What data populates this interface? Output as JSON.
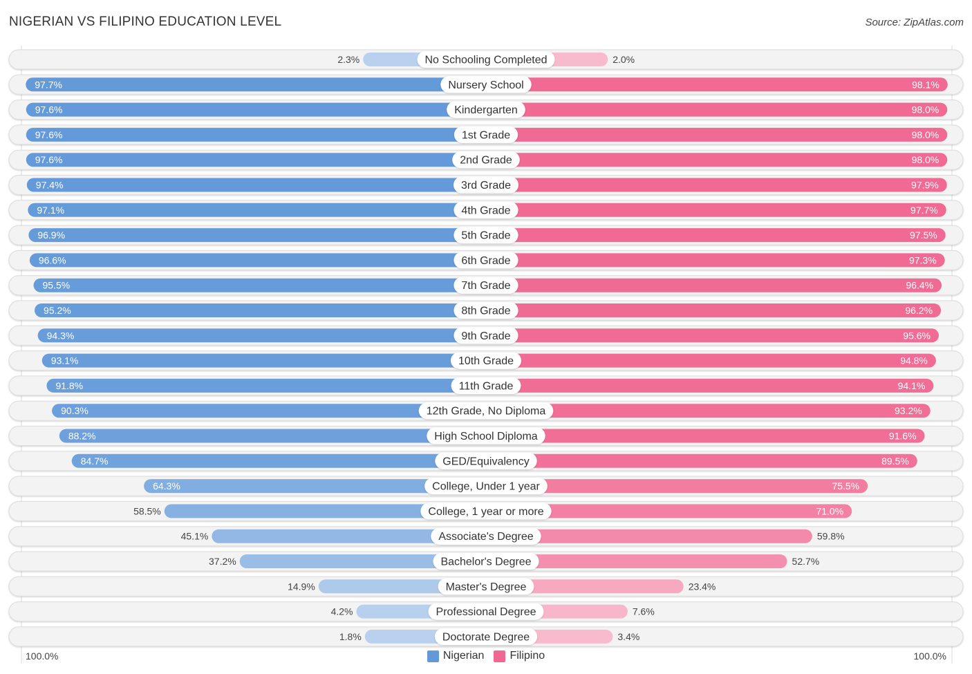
{
  "header": {
    "title": "NIGERIAN VS FILIPINO EDUCATION LEVEL",
    "source": "Source: ZipAtlas.com"
  },
  "colors": {
    "nigerian": "#6399d9",
    "filipino": "#f06892",
    "nigerian_light": "#a9c8ec",
    "filipino_light": "#f7a8c0",
    "row_bg": "#f3f3f3"
  },
  "chart_data": {
    "type": "bar",
    "orientation": "horizontal-diverging",
    "title": "NIGERIAN VS FILIPINO EDUCATION LEVEL",
    "xlabel": "",
    "ylabel": "",
    "xlim": [
      0,
      100
    ],
    "axis_left_label": "100.0%",
    "axis_right_label": "100.0%",
    "legend_position": "bottom-center",
    "categories": [
      "No Schooling Completed",
      "Nursery School",
      "Kindergarten",
      "1st Grade",
      "2nd Grade",
      "3rd Grade",
      "4th Grade",
      "5th Grade",
      "6th Grade",
      "7th Grade",
      "8th Grade",
      "9th Grade",
      "10th Grade",
      "11th Grade",
      "12th Grade, No Diploma",
      "High School Diploma",
      "GED/Equivalency",
      "College, Under 1 year",
      "College, 1 year or more",
      "Associate's Degree",
      "Bachelor's Degree",
      "Master's Degree",
      "Professional Degree",
      "Doctorate Degree"
    ],
    "series": [
      {
        "name": "Nigerian",
        "side": "left",
        "values": [
          2.3,
          97.7,
          97.6,
          97.6,
          97.6,
          97.4,
          97.1,
          96.9,
          96.6,
          95.5,
          95.2,
          94.3,
          93.1,
          91.8,
          90.3,
          88.2,
          84.7,
          64.3,
          58.5,
          45.1,
          37.2,
          14.9,
          4.2,
          1.8
        ],
        "labels": [
          "2.3%",
          "97.7%",
          "97.6%",
          "97.6%",
          "97.6%",
          "97.4%",
          "97.1%",
          "96.9%",
          "96.6%",
          "95.5%",
          "95.2%",
          "94.3%",
          "93.1%",
          "91.8%",
          "90.3%",
          "88.2%",
          "84.7%",
          "64.3%",
          "58.5%",
          "45.1%",
          "37.2%",
          "14.9%",
          "4.2%",
          "1.8%"
        ]
      },
      {
        "name": "Filipino",
        "side": "right",
        "values": [
          2.0,
          98.1,
          98.0,
          98.0,
          98.0,
          97.9,
          97.7,
          97.5,
          97.3,
          96.4,
          96.2,
          95.6,
          94.8,
          94.1,
          93.2,
          91.6,
          89.5,
          75.5,
          71.0,
          59.8,
          52.7,
          23.4,
          7.6,
          3.4
        ],
        "labels": [
          "2.0%",
          "98.1%",
          "98.0%",
          "98.0%",
          "98.0%",
          "97.9%",
          "97.7%",
          "97.5%",
          "97.3%",
          "96.4%",
          "96.2%",
          "95.6%",
          "94.8%",
          "94.1%",
          "93.2%",
          "91.6%",
          "89.5%",
          "75.5%",
          "71.0%",
          "59.8%",
          "52.7%",
          "23.4%",
          "7.6%",
          "3.4%"
        ]
      }
    ],
    "legend": [
      "Nigerian",
      "Filipino"
    ]
  }
}
